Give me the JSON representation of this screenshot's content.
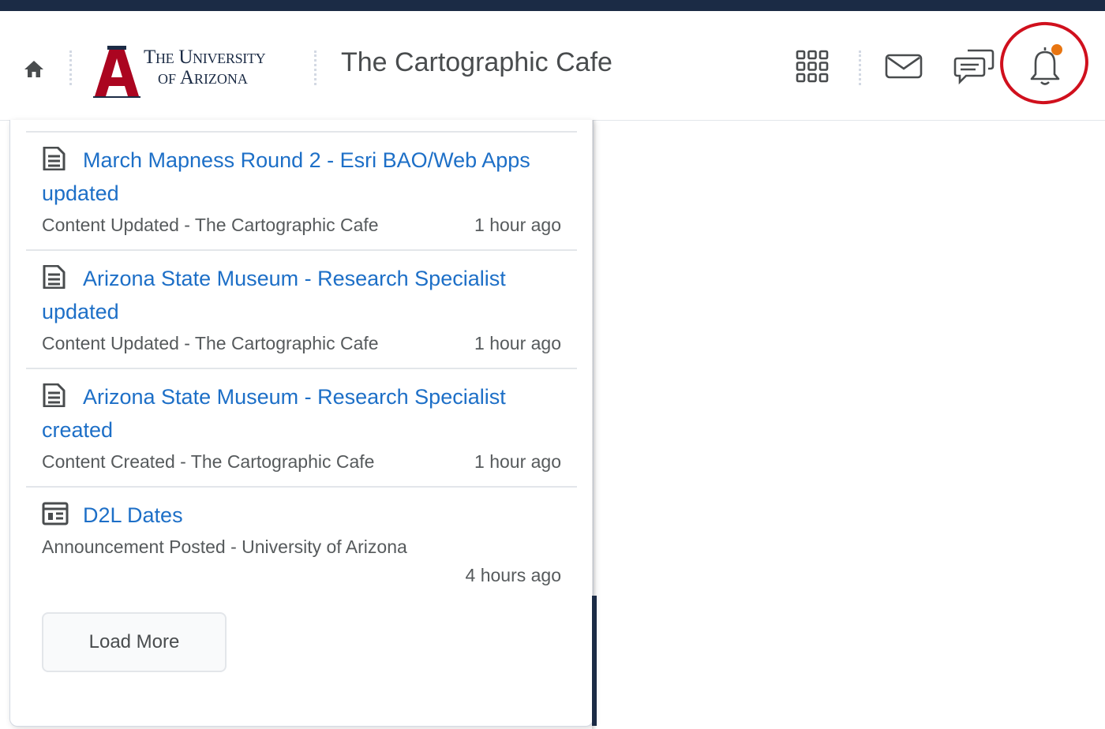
{
  "header": {
    "logo": {
      "line1": "The University",
      "line2": "of Arizona",
      "letter": "A"
    },
    "course_title": "The Cartographic Cafe",
    "icons": [
      "home-icon",
      "waffle-grid-icon",
      "mail-icon",
      "chat-icon",
      "bell-icon"
    ],
    "notification_dot_color": "#e87511",
    "highlight_color": "#d0101d"
  },
  "notifications": {
    "items": [
      {
        "icon": "document-icon",
        "title": "March Mapness Round 2 - Esri BAO/Web Apps updated",
        "source": "Content Updated - The Cartographic Cafe",
        "time": "1 hour ago"
      },
      {
        "icon": "document-icon",
        "title": "Arizona State Museum - Research Specialist updated",
        "source": "Content Updated - The Cartographic Cafe",
        "time": "1 hour ago"
      },
      {
        "icon": "document-icon",
        "title": "Arizona State Museum - Research Specialist created",
        "source": "Content Created - The Cartographic Cafe",
        "time": "1 hour ago"
      },
      {
        "icon": "announcement-icon",
        "title": "D2L Dates",
        "source": "Announcement Posted - University of Arizona",
        "time": "4 hours ago"
      }
    ],
    "load_more_label": "Load More"
  },
  "colors": {
    "link": "#1d6fc7",
    "brand_navy": "#1b2b45",
    "brand_red": "#ab0520"
  }
}
